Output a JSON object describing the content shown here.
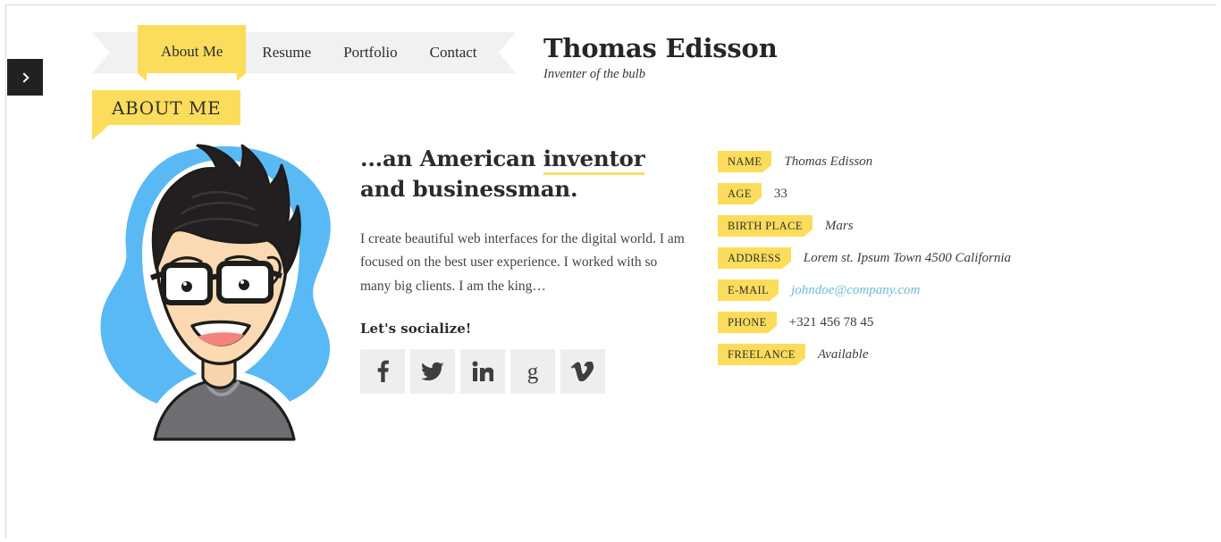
{
  "sidebar_toggle": {
    "icon": "chevron-right-icon",
    "label": ""
  },
  "nav": {
    "items": [
      {
        "label": "About Me",
        "active": true
      },
      {
        "label": "Resume",
        "active": false
      },
      {
        "label": "Portfolio",
        "active": false
      },
      {
        "label": "Contact",
        "active": false
      }
    ]
  },
  "header": {
    "title": "Thomas Edisson",
    "subtitle": "Inventer of the bulb"
  },
  "section": {
    "banner_title": "ABOUT ME"
  },
  "avatar": {
    "alt": "cartoon illustration of a young man with spiky black hair, thick black glasses and a grey t-shirt on a blue blob background"
  },
  "bio": {
    "heading_part1": "...an American ",
    "heading_highlight": "inventor",
    "heading_part2": " and businessman.",
    "paragraph": "I create beautiful web interfaces for the digital world. I am focused on the best user experience. I worked with so many big clients. I am the king…",
    "socialize_label": "Let's socialize!",
    "social": [
      {
        "name": "facebook-icon",
        "glyph": "f"
      },
      {
        "name": "twitter-icon",
        "glyph": "bird"
      },
      {
        "name": "linkedin-icon",
        "glyph": "in"
      },
      {
        "name": "google-icon",
        "glyph": "g"
      },
      {
        "name": "vimeo-icon",
        "glyph": "v"
      }
    ]
  },
  "info": {
    "rows": [
      {
        "label": "NAME",
        "value": "Thomas Edisson",
        "style": "italic"
      },
      {
        "label": "AGE",
        "value": "33",
        "style": "plain"
      },
      {
        "label": "BIRTH PLACE",
        "value": "Mars",
        "style": "italic"
      },
      {
        "label": "ADDRESS",
        "value": "Lorem st. Ipsum Town 4500 California",
        "style": "italic"
      },
      {
        "label": "E-MAIL",
        "value": "johndoe@company.com",
        "style": "email"
      },
      {
        "label": "PHONE",
        "value": "+321 456 78 45",
        "style": "plain"
      },
      {
        "label": "FREELANCE",
        "value": "Available",
        "style": "italic"
      }
    ]
  },
  "colors": {
    "accent_yellow": "#fbdd5b",
    "ribbon_grey": "#f1f1f1",
    "social_tile": "#eeeeee",
    "email_blue": "#6bbcd4",
    "avatar_blue": "#59b9f5",
    "dark": "#212121"
  }
}
